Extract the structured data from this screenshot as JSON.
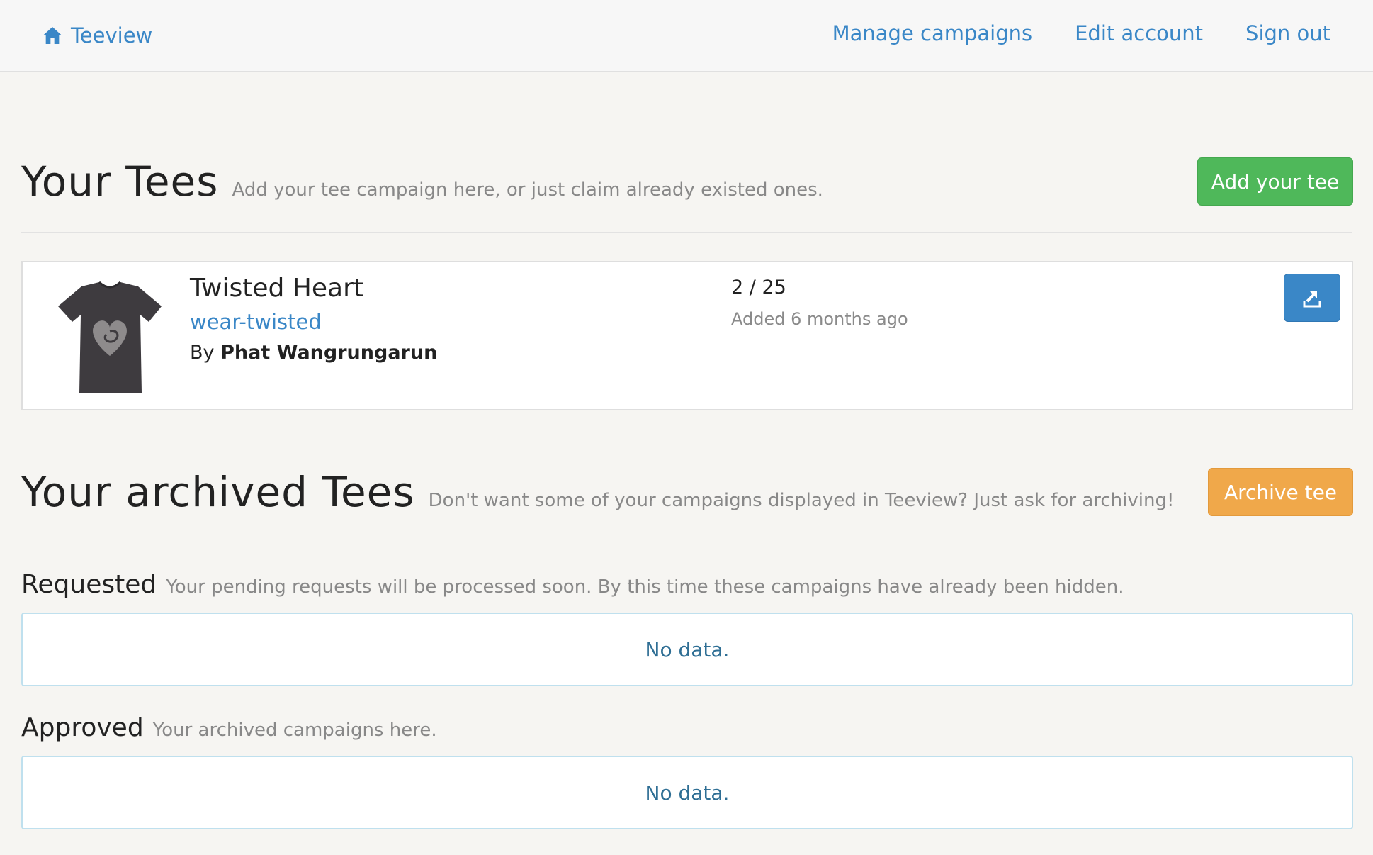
{
  "navbar": {
    "brand": "Teeview",
    "links": [
      "Manage campaigns",
      "Edit account",
      "Sign out"
    ]
  },
  "your_tees": {
    "title": "Your Tees",
    "subtitle": "Add your tee campaign here, or just claim already existed ones.",
    "add_button": "Add your tee",
    "item": {
      "name": "Twisted Heart",
      "slug": "wear-twisted",
      "by_label": "By",
      "author": "Phat Wangrungarun",
      "count": "2 / 25",
      "added": "Added 6 months ago"
    }
  },
  "archived": {
    "title": "Your archived Tees",
    "subtitle": "Don't want some of your campaigns displayed in Teeview? Just ask for archiving!",
    "archive_button": "Archive tee",
    "requested": {
      "title": "Requested",
      "subtitle": "Your pending requests will be processed soon. By this time these campaigns have already been hidden.",
      "empty": "No data."
    },
    "approved": {
      "title": "Approved",
      "subtitle": "Your archived campaigns here.",
      "empty": "No data."
    }
  },
  "colors": {
    "link": "#3a87c7",
    "add_button": "#4fb85a",
    "archive_button": "#f0a84a",
    "export_button": "#3a87c7"
  }
}
